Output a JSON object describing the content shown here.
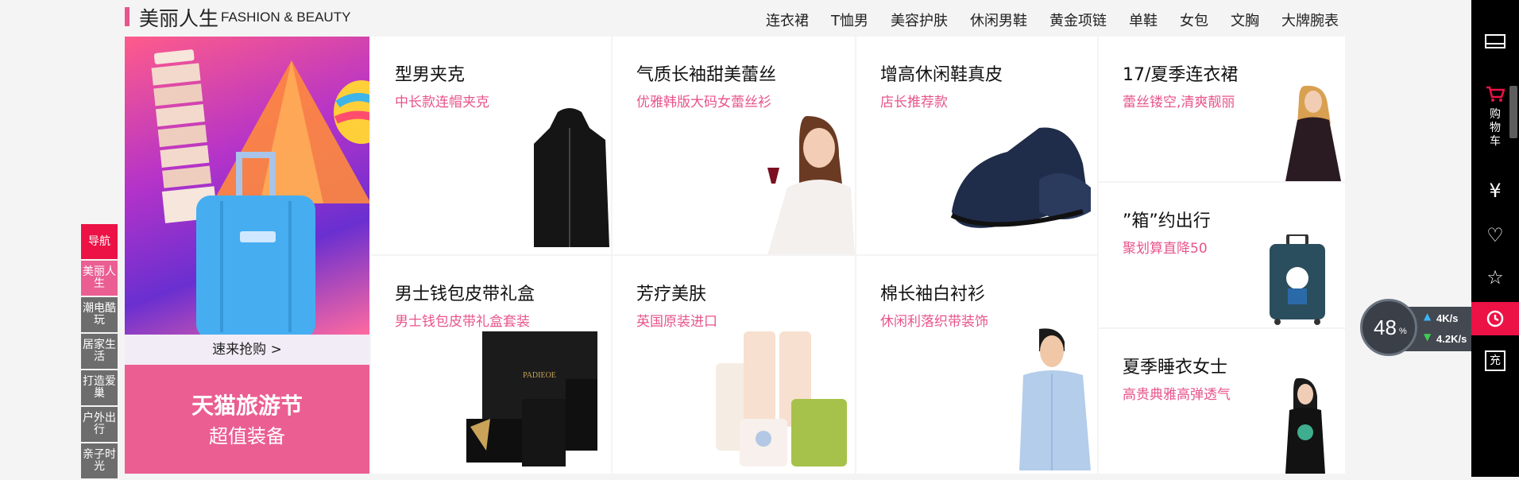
{
  "header": {
    "title": "美丽人生",
    "subtitle": "FASHION & BEAUTY"
  },
  "categories": [
    "连衣裙",
    "T恤男",
    "美容护肤",
    "休闲男鞋",
    "黄金项链",
    "单鞋",
    "女包",
    "文胸",
    "大牌腕表"
  ],
  "promo": {
    "cta": "速来抢购 >",
    "title": "天猫旅游节",
    "subtitle": "超值装备"
  },
  "products": [
    {
      "title": "型男夹克",
      "subtitle": "中长款连帽夹克",
      "image": "jacket"
    },
    {
      "title": "气质长袖甜美蕾丝",
      "subtitle": "优雅韩版大码女蕾丝衫",
      "image": "woman-wine"
    },
    {
      "title": "增高休闲鞋真皮",
      "subtitle": "店长推荐款",
      "image": "leather-shoe"
    },
    {
      "title": "17/夏季连衣裙",
      "subtitle": "蕾丝镂空,清爽靓丽",
      "image": "dress-model"
    },
    {
      "title": "男士钱包皮带礼盒",
      "subtitle": "男士钱包皮带礼盒套装",
      "image": "wallet-giftbox",
      "brand": "PADIEOE"
    },
    {
      "title": "芳疗美肤",
      "subtitle": "英国原装进口",
      "image": "skincare-bottles"
    },
    {
      "title": "棉长袖白衬衫",
      "subtitle": "休闲利落织带装饰",
      "image": "shirt-model"
    },
    {
      "title": "”箱”约出行",
      "subtitle": "聚划算直降50",
      "image": "suitcase"
    },
    {
      "title": "夏季睡衣女士",
      "subtitle": "高贵典雅高弹透气",
      "image": "pajama-model"
    }
  ],
  "side_nav": [
    "导航",
    "美丽人生",
    "潮电酷玩",
    "居家生活",
    "打造爱巢",
    "户外出行",
    "亲子时光"
  ],
  "right_toolbar": {
    "cart_label": "购物车",
    "icons": [
      "mail-icon",
      "cart-icon",
      "yen-icon",
      "heart-icon",
      "star-icon",
      "history-icon",
      "recharge-icon"
    ],
    "recharge_label": "充"
  },
  "speed_widget": {
    "percent": "48",
    "percent_sign": "%",
    "upload": "4K/s",
    "download": "4.2K/s"
  },
  "colors": {
    "accent": "#e8548b",
    "nav_active": "#ec1246",
    "toolbar": "#000000"
  }
}
